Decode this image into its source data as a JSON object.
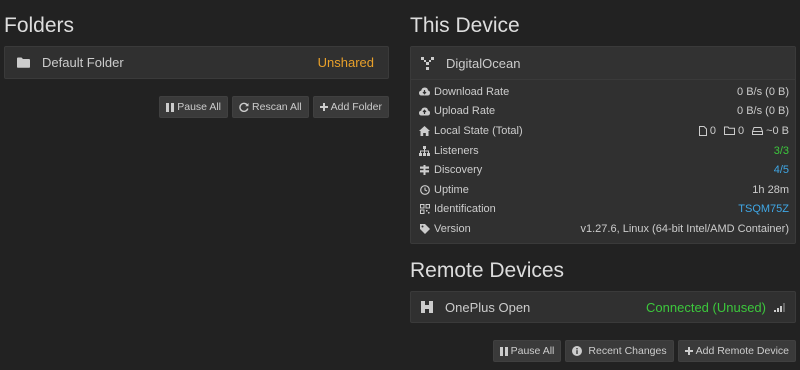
{
  "folders": {
    "title": "Folders",
    "items": [
      {
        "name": "Default Folder",
        "status": "Unshared",
        "icon": "folder-icon"
      }
    ],
    "buttons": {
      "pause_all": "Pause All",
      "rescan_all": "Rescan All",
      "add_folder": "Add Folder"
    }
  },
  "this_device": {
    "title": "This Device",
    "name": "DigitalOcean",
    "rows": [
      {
        "label": "Download Rate",
        "value": "0 B/s (0 B)",
        "icon": "cloud-download-icon"
      },
      {
        "label": "Upload Rate",
        "value": "0 B/s (0 B)",
        "icon": "cloud-upload-icon"
      },
      {
        "label": "Local State (Total)",
        "files": "0",
        "dirs": "0",
        "size": "~0 B",
        "icon": "home-icon"
      },
      {
        "label": "Listeners",
        "value": "3/3",
        "icon": "sitemap-icon"
      },
      {
        "label": "Discovery",
        "value": "4/5",
        "icon": "signpost-icon"
      },
      {
        "label": "Uptime",
        "value": "1h 28m",
        "icon": "clock-icon"
      },
      {
        "label": "Identification",
        "value": "TSQM75Z",
        "icon": "qrcode-icon"
      },
      {
        "label": "Version",
        "value": "v1.27.6, Linux (64-bit Intel/AMD Container)",
        "icon": "tag-icon"
      }
    ]
  },
  "remote_devices": {
    "title": "Remote Devices",
    "items": [
      {
        "name": "OnePlus Open",
        "status": "Connected (Unused)",
        "icon": "device-icon"
      }
    ],
    "buttons": {
      "pause_all": "Pause All",
      "recent_changes": "Recent Changes",
      "add_remote": "Add Remote Device"
    }
  },
  "colors": {
    "background": "#222222",
    "panel": "#303030",
    "warning": "#e8a02a",
    "success": "#3cc73c",
    "info": "#3fa7e6"
  }
}
